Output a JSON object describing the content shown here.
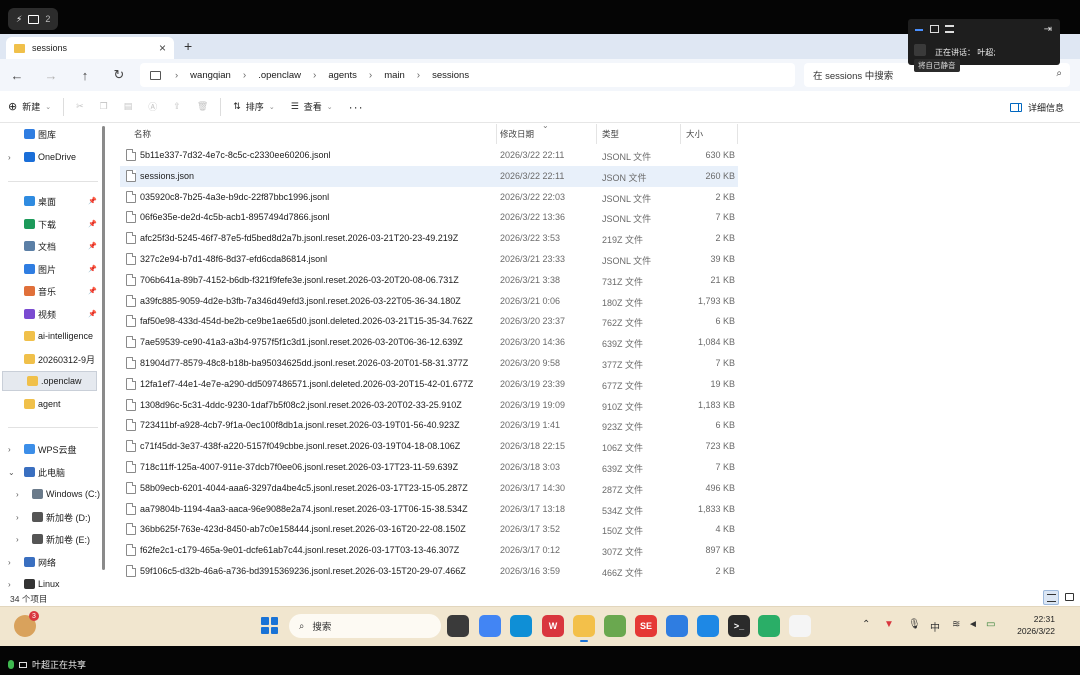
{
  "meeting": {
    "participant_count": "2",
    "share_status": "叶超正在共享"
  },
  "overlay": {
    "speaking_label": "正在讲话：",
    "speaker": "叶超;",
    "mute_tooltip": "将自己静音"
  },
  "tab": {
    "title": "sessions"
  },
  "address": {
    "crumbs": [
      "wangqian",
      ".openclaw",
      "agents",
      "main",
      "sessions"
    ]
  },
  "search": {
    "placeholder": "在 sessions 中搜索"
  },
  "toolbar": {
    "new_label": "新建",
    "sort_label": "排序",
    "view_label": "查看",
    "details_label": "详细信息"
  },
  "sidebar": {
    "items": [
      {
        "label": "图库",
        "icon": "gallery-icon",
        "color": "#2f7de1"
      },
      {
        "label": "OneDrive",
        "icon": "onedrive-icon",
        "color": "#1a6ed8"
      },
      {
        "label": "桌面",
        "icon": "desktop-icon",
        "color": "#2f8be0"
      },
      {
        "label": "下载",
        "icon": "download-icon",
        "color": "#1c9a5a"
      },
      {
        "label": "文档",
        "icon": "documents-icon",
        "color": "#5b7fa6"
      },
      {
        "label": "图片",
        "icon": "pictures-icon",
        "color": "#2f7de1"
      },
      {
        "label": "音乐",
        "icon": "music-icon",
        "color": "#e0703a"
      },
      {
        "label": "视频",
        "icon": "videos-icon",
        "color": "#7a4bd1"
      },
      {
        "label": "ai-intelligence",
        "icon": "folder-icon",
        "color": "#f0c04a"
      },
      {
        "label": "20260312-9月",
        "icon": "folder-icon",
        "color": "#f0c04a"
      },
      {
        "label": ".openclaw",
        "icon": "folder-icon",
        "color": "#f0c04a"
      },
      {
        "label": "agent",
        "icon": "folder-icon",
        "color": "#f0c04a"
      },
      {
        "label": "WPS云盘",
        "icon": "wps-cloud-icon",
        "color": "#3c8ee8"
      },
      {
        "label": "此电脑",
        "icon": "this-pc-icon",
        "color": "#3a6fc0"
      },
      {
        "label": "Windows (C:)",
        "icon": "drive-c-icon",
        "color": "#6a7a8a"
      },
      {
        "label": "新加卷 (D:)",
        "icon": "drive-d-icon",
        "color": "#555555"
      },
      {
        "label": "新加卷 (E:)",
        "icon": "drive-e-icon",
        "color": "#555555"
      },
      {
        "label": "网络",
        "icon": "network-icon",
        "color": "#3a6fc0"
      },
      {
        "label": "Linux",
        "icon": "linux-icon",
        "color": "#333333"
      }
    ]
  },
  "columns": {
    "name": "名称",
    "date": "修改日期",
    "type": "类型",
    "size": "大小"
  },
  "files": [
    {
      "name": "5b11e337-7d32-4e7c-8c5c-c2330ee60206.jsonl",
      "date": "2026/3/22 22:11",
      "type": "JSONL 文件",
      "size": "630 KB"
    },
    {
      "name": "sessions.json",
      "date": "2026/3/22 22:11",
      "type": "JSON 文件",
      "size": "260 KB"
    },
    {
      "name": "035920c8-7b25-4a3e-b9dc-22f87bbc1996.jsonl",
      "date": "2026/3/22 22:03",
      "type": "JSONL 文件",
      "size": "2 KB"
    },
    {
      "name": "06f6e35e-de2d-4c5b-acb1-8957494d7866.jsonl",
      "date": "2026/3/22 13:36",
      "type": "JSONL 文件",
      "size": "7 KB"
    },
    {
      "name": "afc25f3d-5245-46f7-87e5-fd5bed8d2a7b.jsonl.reset.2026-03-21T20-23-49.219Z",
      "date": "2026/3/22 3:53",
      "type": "219Z 文件",
      "size": "2 KB"
    },
    {
      "name": "327c2e94-b7d1-48f6-8d37-efd6cda86814.jsonl",
      "date": "2026/3/21 23:33",
      "type": "JSONL 文件",
      "size": "39 KB"
    },
    {
      "name": "706b641a-89b7-4152-b6db-f321f9fefe3e.jsonl.reset.2026-03-20T20-08-06.731Z",
      "date": "2026/3/21 3:38",
      "type": "731Z 文件",
      "size": "21 KB"
    },
    {
      "name": "a39fc885-9059-4d2e-b3fb-7a346d49efd3.jsonl.reset.2026-03-22T05-36-34.180Z",
      "date": "2026/3/21 0:06",
      "type": "180Z 文件",
      "size": "1,793 KB"
    },
    {
      "name": "faf50e98-433d-454d-be2b-ce9be1ae65d0.jsonl.deleted.2026-03-21T15-35-34.762Z",
      "date": "2026/3/20 23:37",
      "type": "762Z 文件",
      "size": "6 KB"
    },
    {
      "name": "7ae59539-ce90-41a3-a3b4-9757f5f1c3d1.jsonl.reset.2026-03-20T06-36-12.639Z",
      "date": "2026/3/20 14:36",
      "type": "639Z 文件",
      "size": "1,084 KB"
    },
    {
      "name": "81904d77-8579-48c8-b18b-ba95034625dd.jsonl.reset.2026-03-20T01-58-31.377Z",
      "date": "2026/3/20 9:58",
      "type": "377Z 文件",
      "size": "7 KB"
    },
    {
      "name": "12fa1ef7-44e1-4e7e-a290-dd5097486571.jsonl.deleted.2026-03-20T15-42-01.677Z",
      "date": "2026/3/19 23:39",
      "type": "677Z 文件",
      "size": "19 KB"
    },
    {
      "name": "1308d96c-5c31-4ddc-9230-1daf7b5f08c2.jsonl.reset.2026-03-20T02-33-25.910Z",
      "date": "2026/3/19 19:09",
      "type": "910Z 文件",
      "size": "1,183 KB"
    },
    {
      "name": "723411bf-a928-4cb7-9f1a-0ec100f8db1a.jsonl.reset.2026-03-19T01-56-40.923Z",
      "date": "2026/3/19 1:41",
      "type": "923Z 文件",
      "size": "6 KB"
    },
    {
      "name": "c71f45dd-3e37-438f-a220-5157f049cbbe.jsonl.reset.2026-03-19T04-18-08.106Z",
      "date": "2026/3/18 22:15",
      "type": "106Z 文件",
      "size": "723 KB"
    },
    {
      "name": "718c11ff-125a-4007-911e-37dcb7f0ee06.jsonl.reset.2026-03-17T23-11-59.639Z",
      "date": "2026/3/18 3:03",
      "type": "639Z 文件",
      "size": "7 KB"
    },
    {
      "name": "58b09ecb-6201-4044-aaa6-3297da4be4c5.jsonl.reset.2026-03-17T23-15-05.287Z",
      "date": "2026/3/17 14:30",
      "type": "287Z 文件",
      "size": "496 KB"
    },
    {
      "name": "aa79804b-1194-4aa3-aaca-96e9088e2a74.jsonl.reset.2026-03-17T06-15-38.534Z",
      "date": "2026/3/17 13:18",
      "type": "534Z 文件",
      "size": "1,833 KB"
    },
    {
      "name": "36bb625f-763e-423d-8450-ab7c0e158444.jsonl.reset.2026-03-16T20-22-08.150Z",
      "date": "2026/3/17 3:52",
      "type": "150Z 文件",
      "size": "4 KB"
    },
    {
      "name": "f62fe2c1-c179-465a-9e01-dcfe61ab7c44.jsonl.reset.2026-03-17T03-13-46.307Z",
      "date": "2026/3/17 0:12",
      "type": "307Z 文件",
      "size": "897 KB"
    },
    {
      "name": "59f106c5-d32b-46a6-a736-bd3915369236.jsonl.reset.2026-03-15T20-29-07.466Z",
      "date": "2026/3/16 3:59",
      "type": "466Z 文件",
      "size": "2 KB"
    }
  ],
  "status": {
    "count_label": "34 个项目"
  },
  "taskbar": {
    "widget_badge": "3",
    "search_placeholder": "搜索",
    "apps": [
      {
        "name": "taskview",
        "glyph": "",
        "color": "#3a3a3a"
      },
      {
        "name": "chrome",
        "glyph": "",
        "color": "#4285f4"
      },
      {
        "name": "edge",
        "glyph": "",
        "color": "#0f8fd6"
      },
      {
        "name": "wps",
        "glyph": "W",
        "color": "#d9363e"
      },
      {
        "name": "explorer",
        "glyph": "",
        "color": "#f3c04a"
      },
      {
        "name": "app-green",
        "glyph": "",
        "color": "#6aa84f"
      },
      {
        "name": "app-se",
        "glyph": "SE",
        "color": "#e53935"
      },
      {
        "name": "app-blue",
        "glyph": "",
        "color": "#2f7de1"
      },
      {
        "name": "app-cloud",
        "glyph": "",
        "color": "#1e88e5"
      },
      {
        "name": "terminal",
        "glyph": ">_",
        "color": "#2b2b2b"
      },
      {
        "name": "wechat",
        "glyph": "",
        "color": "#2aae67"
      },
      {
        "name": "app-panda",
        "glyph": "",
        "color": "#f5f5f5"
      }
    ],
    "ime": "中",
    "time": "22:31",
    "date": "2026/3/22"
  }
}
